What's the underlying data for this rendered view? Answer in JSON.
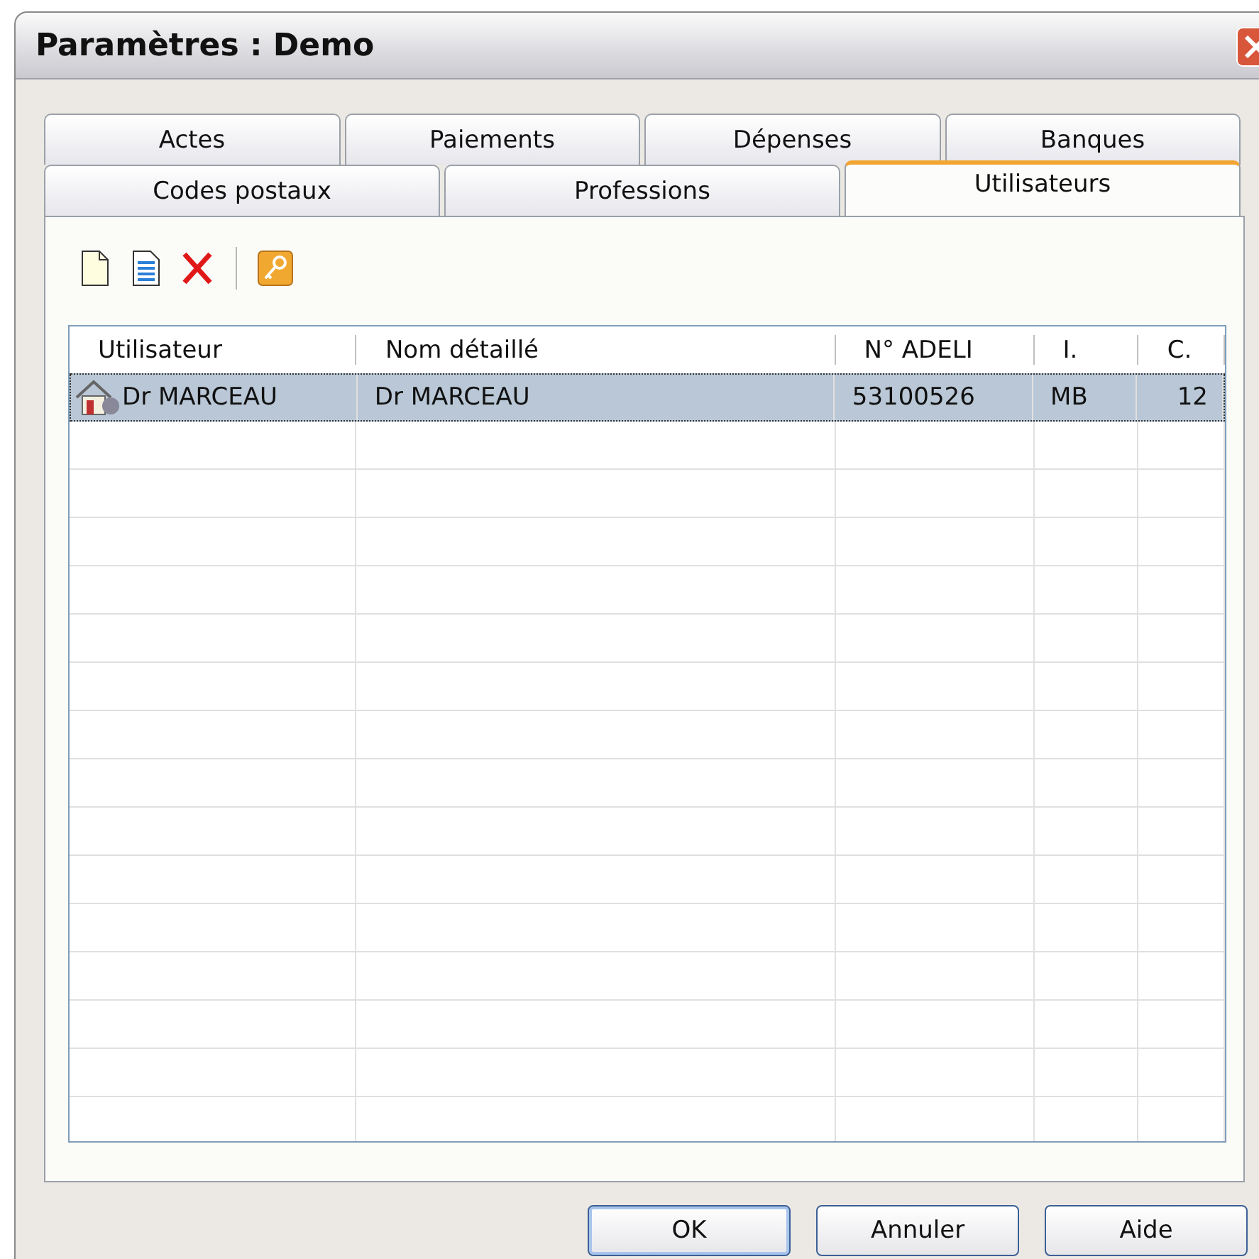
{
  "window": {
    "title": "Paramètres : Demo"
  },
  "tab_rows": [
    [
      {
        "label": "Actes",
        "selected": false
      },
      {
        "label": "Paiements",
        "selected": false
      },
      {
        "label": "Dépenses",
        "selected": false
      },
      {
        "label": "Banques",
        "selected": false
      }
    ],
    [
      {
        "label": "Codes postaux",
        "selected": false
      },
      {
        "label": "Professions",
        "selected": false
      },
      {
        "label": "Utilisateurs",
        "selected": true
      }
    ]
  ],
  "toolbar": [
    {
      "kind": "new"
    },
    {
      "kind": "edit"
    },
    {
      "kind": "delete"
    },
    {
      "kind": "separator"
    },
    {
      "kind": "key"
    }
  ],
  "table": {
    "columns": [
      "Utilisateur",
      "Nom détaillé",
      "N° ADELI",
      "I.",
      "C."
    ],
    "rows": [
      {
        "selected": true,
        "cells": [
          "Dr MARCEAU",
          "Dr MARCEAU",
          "53100526",
          "MB",
          "12"
        ]
      }
    ]
  },
  "buttons": [
    "OK",
    "Annuler",
    "Aide"
  ]
}
